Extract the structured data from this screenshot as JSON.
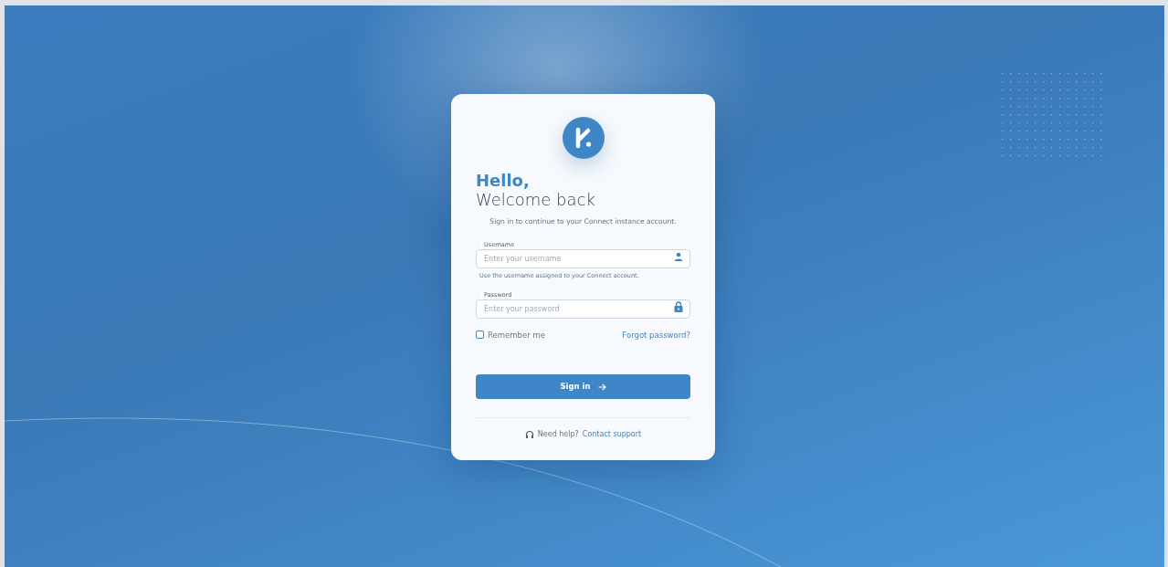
{
  "heading": {
    "greeting": "Hello,",
    "title": "Welcome back"
  },
  "subtitle": "Sign in to continue to your Connect instance account.",
  "fields": [
    {
      "kind": "text",
      "label": "Username",
      "placeholder": "Enter your username",
      "hint": "Use the username assigned to your Connect account."
    },
    {
      "kind": "password",
      "label": "Password",
      "placeholder": "Enter your password"
    }
  ],
  "remember": {
    "label": "Remember me",
    "checked": false
  },
  "forgot_link": "Forgot password?",
  "sign_in_button": "Sign in",
  "help": {
    "text": "Need help?",
    "link": "Contact support"
  }
}
